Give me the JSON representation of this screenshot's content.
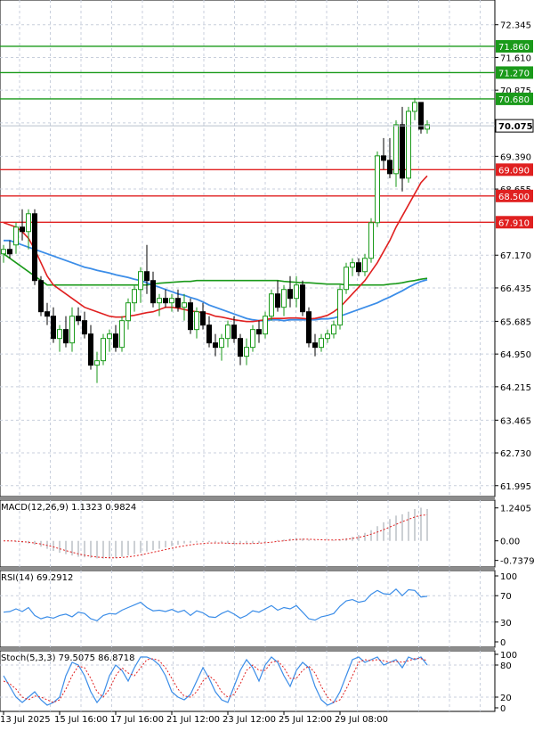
{
  "chart_data": {
    "type": "candlestick",
    "price_panel": {
      "y_axis_ticks": [
        "72.345",
        "71.610",
        "70.875",
        "70.140",
        "69.390",
        "68.655",
        "67.170",
        "66.435",
        "65.685",
        "64.950",
        "64.215",
        "63.465",
        "62.730",
        "61.995"
      ],
      "ylim": [
        61.75,
        72.9
      ],
      "current_price": "70.075",
      "levels": [
        {
          "label": "71.860",
          "value": 71.86,
          "color": "#1a9a1a"
        },
        {
          "label": "71.270",
          "value": 71.27,
          "color": "#1a9a1a"
        },
        {
          "label": "70.680",
          "value": 70.68,
          "color": "#1a9a1a"
        },
        {
          "label": "69.090",
          "value": 69.09,
          "color": "#e02020"
        },
        {
          "label": "68.500",
          "value": 68.5,
          "color": "#e02020"
        },
        {
          "label": "67.910",
          "value": 67.91,
          "color": "#e02020"
        }
      ],
      "candles": [
        [
          67.2,
          67.4,
          67.0,
          67.3
        ],
        [
          67.3,
          67.5,
          67.1,
          67.2
        ],
        [
          67.4,
          67.9,
          67.2,
          67.8
        ],
        [
          67.8,
          68.2,
          67.5,
          67.7
        ],
        [
          67.7,
          68.2,
          67.3,
          68.1
        ],
        [
          68.1,
          68.2,
          66.5,
          66.6
        ],
        [
          66.6,
          66.7,
          65.8,
          65.9
        ],
        [
          65.9,
          66.1,
          65.6,
          65.8
        ],
        [
          65.8,
          66.0,
          65.2,
          65.3
        ],
        [
          65.3,
          65.6,
          65.0,
          65.5
        ],
        [
          65.5,
          65.8,
          65.1,
          65.2
        ],
        [
          65.2,
          66.0,
          65.0,
          65.8
        ],
        [
          65.8,
          66.0,
          65.6,
          65.7
        ],
        [
          65.7,
          65.9,
          65.3,
          65.4
        ],
        [
          65.4,
          65.6,
          64.6,
          64.7
        ],
        [
          64.7,
          65.0,
          64.3,
          64.8
        ],
        [
          64.8,
          65.4,
          64.7,
          65.3
        ],
        [
          65.3,
          65.5,
          65.0,
          65.4
        ],
        [
          65.4,
          65.6,
          65.0,
          65.1
        ],
        [
          65.1,
          65.8,
          65.0,
          65.7
        ],
        [
          65.7,
          66.2,
          65.5,
          66.1
        ],
        [
          66.1,
          66.5,
          65.9,
          66.4
        ],
        [
          66.4,
          66.9,
          66.1,
          66.8
        ],
        [
          66.8,
          67.4,
          66.3,
          66.6
        ],
        [
          66.6,
          66.8,
          66.0,
          66.1
        ],
        [
          66.1,
          66.3,
          65.8,
          66.2
        ],
        [
          66.2,
          66.4,
          66.0,
          66.1
        ],
        [
          66.1,
          66.3,
          65.9,
          66.2
        ],
        [
          66.2,
          66.4,
          65.9,
          66.0
        ],
        [
          66.0,
          66.3,
          65.7,
          66.1
        ],
        [
          66.1,
          66.2,
          65.4,
          65.5
        ],
        [
          65.5,
          66.0,
          65.3,
          65.9
        ],
        [
          65.9,
          66.1,
          65.5,
          65.6
        ],
        [
          65.6,
          65.8,
          65.1,
          65.2
        ],
        [
          65.2,
          65.4,
          64.9,
          65.1
        ],
        [
          65.1,
          65.4,
          64.8,
          65.3
        ],
        [
          65.3,
          65.7,
          65.1,
          65.6
        ],
        [
          65.6,
          65.8,
          65.2,
          65.3
        ],
        [
          65.3,
          65.4,
          64.7,
          64.9
        ],
        [
          64.9,
          65.3,
          64.7,
          65.1
        ],
        [
          65.1,
          65.6,
          65.0,
          65.5
        ],
        [
          65.5,
          65.7,
          65.2,
          65.4
        ],
        [
          65.4,
          65.9,
          65.3,
          65.8
        ],
        [
          65.8,
          66.4,
          65.7,
          66.3
        ],
        [
          66.3,
          66.6,
          65.9,
          66.0
        ],
        [
          66.0,
          66.5,
          65.8,
          66.4
        ],
        [
          66.4,
          66.7,
          66.0,
          66.2
        ],
        [
          66.2,
          66.7,
          66.0,
          66.5
        ],
        [
          66.5,
          66.6,
          65.8,
          65.9
        ],
        [
          65.9,
          66.0,
          65.1,
          65.2
        ],
        [
          65.2,
          65.4,
          64.9,
          65.1
        ],
        [
          65.1,
          65.4,
          65.0,
          65.3
        ],
        [
          65.3,
          65.5,
          65.2,
          65.4
        ],
        [
          65.4,
          65.7,
          65.3,
          65.6
        ],
        [
          65.6,
          66.5,
          65.5,
          66.4
        ],
        [
          66.4,
          67.0,
          66.3,
          66.9
        ],
        [
          66.9,
          67.1,
          66.7,
          67.0
        ],
        [
          67.0,
          67.1,
          66.7,
          66.8
        ],
        [
          66.8,
          67.2,
          66.7,
          67.1
        ],
        [
          67.1,
          68.0,
          67.0,
          67.9
        ],
        [
          67.9,
          69.5,
          67.8,
          69.4
        ],
        [
          69.4,
          69.8,
          69.1,
          69.3
        ],
        [
          69.3,
          69.8,
          68.9,
          69.0
        ],
        [
          69.0,
          70.2,
          68.7,
          70.1
        ],
        [
          70.1,
          70.5,
          68.6,
          68.9
        ],
        [
          68.9,
          70.5,
          68.8,
          70.4
        ],
        [
          70.4,
          70.7,
          70.2,
          70.6
        ],
        [
          70.6,
          70.6,
          69.9,
          70.0
        ],
        [
          70.0,
          70.2,
          69.9,
          70.1
        ]
      ],
      "sma_fast_red": [
        67.9,
        67.85,
        67.8,
        67.7,
        67.55,
        67.3,
        67.0,
        66.7,
        66.5,
        66.4,
        66.3,
        66.2,
        66.1,
        66.0,
        65.95,
        65.9,
        65.85,
        65.8,
        65.78,
        65.78,
        65.8,
        65.82,
        65.85,
        65.88,
        65.9,
        65.95,
        66.0,
        66.0,
        65.98,
        65.95,
        65.92,
        65.9,
        65.88,
        65.85,
        65.8,
        65.78,
        65.75,
        65.72,
        65.7,
        65.68,
        65.68,
        65.7,
        65.72,
        65.75,
        65.75,
        65.75,
        65.76,
        65.76,
        65.75,
        65.74,
        65.75,
        65.78,
        65.82,
        65.9,
        66.0,
        66.15,
        66.3,
        66.45,
        66.6,
        66.8,
        67.0,
        67.25,
        67.5,
        67.8,
        68.05,
        68.3,
        68.55,
        68.8,
        68.95
      ],
      "sma_mid_blue": [
        67.5,
        67.5,
        67.45,
        67.4,
        67.35,
        67.3,
        67.25,
        67.2,
        67.15,
        67.1,
        67.05,
        67.0,
        66.95,
        66.9,
        66.87,
        66.83,
        66.8,
        66.77,
        66.73,
        66.7,
        66.67,
        66.63,
        66.6,
        66.55,
        66.5,
        66.45,
        66.4,
        66.35,
        66.3,
        66.27,
        66.22,
        66.18,
        66.12,
        66.05,
        66.0,
        65.95,
        65.9,
        65.85,
        65.8,
        65.75,
        65.72,
        65.7,
        65.7,
        65.72,
        65.72,
        65.7,
        65.72,
        65.72,
        65.72,
        65.72,
        65.72,
        65.74,
        65.74,
        65.76,
        65.8,
        65.85,
        65.9,
        65.95,
        66.0,
        66.05,
        66.1,
        66.17,
        66.23,
        66.3,
        66.37,
        66.45,
        66.52,
        66.58,
        66.62
      ],
      "sma_slow_green": [
        67.2,
        67.1,
        67.0,
        66.9,
        66.8,
        66.7,
        66.6,
        66.5,
        66.5,
        66.5,
        66.5,
        66.5,
        66.5,
        66.5,
        66.5,
        66.5,
        66.5,
        66.5,
        66.5,
        66.5,
        66.5,
        66.5,
        66.5,
        66.5,
        66.52,
        66.54,
        66.55,
        66.56,
        66.57,
        66.58,
        66.58,
        66.6,
        66.6,
        66.6,
        66.6,
        66.6,
        66.6,
        66.6,
        66.6,
        66.6,
        66.6,
        66.6,
        66.6,
        66.6,
        66.6,
        66.58,
        66.57,
        66.56,
        66.55,
        66.55,
        66.54,
        66.53,
        66.52,
        66.52,
        66.52,
        66.5,
        66.5,
        66.5,
        66.5,
        66.5,
        66.5,
        66.5,
        66.52,
        66.53,
        66.55,
        66.58,
        66.6,
        66.63,
        66.65
      ]
    },
    "macd_panel": {
      "label": "MACD(12,26,9) 1.1323 0.9824",
      "y_axis_ticks": [
        "1.2405",
        "0.00",
        "-0.7379"
      ],
      "ylim": [
        -0.85,
        1.4
      ],
      "histogram": [
        0.0,
        -0.02,
        -0.05,
        -0.07,
        -0.1,
        -0.15,
        -0.22,
        -0.3,
        -0.38,
        -0.45,
        -0.5,
        -0.55,
        -0.6,
        -0.62,
        -0.64,
        -0.66,
        -0.67,
        -0.66,
        -0.65,
        -0.6,
        -0.55,
        -0.5,
        -0.45,
        -0.4,
        -0.35,
        -0.3,
        -0.25,
        -0.2,
        -0.15,
        -0.1,
        -0.08,
        -0.06,
        -0.05,
        -0.05,
        -0.06,
        -0.08,
        -0.1,
        -0.12,
        -0.12,
        -0.12,
        -0.1,
        -0.08,
        -0.05,
        0.0,
        0.03,
        0.05,
        0.08,
        0.1,
        0.08,
        0.05,
        0.02,
        0.0,
        0.0,
        0.02,
        0.05,
        0.1,
        0.15,
        0.22,
        0.3,
        0.4,
        0.55,
        0.7,
        0.82,
        0.95,
        1.0,
        1.1,
        1.2,
        1.25,
        1.2
      ],
      "signal": [
        0.0,
        0.0,
        -0.01,
        -0.03,
        -0.05,
        -0.08,
        -0.12,
        -0.17,
        -0.23,
        -0.3,
        -0.37,
        -0.43,
        -0.49,
        -0.54,
        -0.58,
        -0.61,
        -0.63,
        -0.64,
        -0.64,
        -0.63,
        -0.6,
        -0.57,
        -0.53,
        -0.48,
        -0.43,
        -0.38,
        -0.33,
        -0.28,
        -0.23,
        -0.19,
        -0.15,
        -0.12,
        -0.1,
        -0.08,
        -0.08,
        -0.08,
        -0.09,
        -0.1,
        -0.1,
        -0.1,
        -0.1,
        -0.09,
        -0.07,
        -0.05,
        -0.02,
        0.0,
        0.03,
        0.05,
        0.06,
        0.06,
        0.05,
        0.04,
        0.03,
        0.03,
        0.04,
        0.06,
        0.09,
        0.13,
        0.18,
        0.25,
        0.33,
        0.42,
        0.52,
        0.62,
        0.72,
        0.81,
        0.9,
        0.96,
        0.98
      ]
    },
    "rsi_panel": {
      "label": "RSI(14) 69.2912",
      "y_axis_ticks": [
        "100",
        "70",
        "30",
        "0"
      ],
      "ylim": [
        0,
        100
      ],
      "values": [
        45,
        46,
        50,
        46,
        52,
        40,
        35,
        38,
        36,
        40,
        42,
        38,
        45,
        43,
        35,
        32,
        40,
        43,
        42,
        48,
        52,
        56,
        60,
        52,
        47,
        48,
        46,
        49,
        45,
        48,
        40,
        47,
        44,
        38,
        37,
        43,
        47,
        42,
        36,
        40,
        47,
        45,
        50,
        55,
        48,
        52,
        50,
        55,
        45,
        35,
        33,
        38,
        40,
        43,
        54,
        62,
        64,
        60,
        62,
        72,
        78,
        73,
        72,
        80,
        70,
        79,
        78,
        68,
        69
      ]
    },
    "stoch_panel": {
      "label": "Stoch(5,3,3) 79.5075 86.8718",
      "y_axis_ticks": [
        "100",
        "80",
        "20",
        "0"
      ],
      "ylim": [
        0,
        100
      ],
      "k": [
        60,
        40,
        20,
        10,
        20,
        30,
        15,
        5,
        10,
        20,
        60,
        85,
        80,
        60,
        30,
        10,
        25,
        60,
        80,
        70,
        50,
        75,
        95,
        95,
        90,
        80,
        60,
        30,
        20,
        15,
        25,
        50,
        75,
        55,
        30,
        15,
        10,
        40,
        70,
        90,
        75,
        50,
        80,
        95,
        85,
        60,
        40,
        70,
        85,
        75,
        40,
        15,
        5,
        10,
        30,
        60,
        90,
        95,
        85,
        90,
        95,
        80,
        85,
        90,
        75,
        95,
        90,
        95,
        80
      ],
      "d": [
        50,
        45,
        35,
        20,
        15,
        22,
        20,
        15,
        10,
        15,
        35,
        60,
        78,
        75,
        55,
        30,
        20,
        35,
        60,
        75,
        65,
        60,
        75,
        90,
        92,
        88,
        75,
        55,
        35,
        22,
        20,
        30,
        50,
        60,
        50,
        30,
        20,
        25,
        45,
        70,
        80,
        70,
        70,
        85,
        88,
        75,
        55,
        55,
        70,
        78,
        65,
        40,
        20,
        10,
        15,
        35,
        60,
        85,
        90,
        88,
        90,
        88,
        85,
        87,
        85,
        88,
        92,
        92,
        88
      ]
    },
    "x_axis_labels": [
      {
        "label": "13 Jul 2025",
        "index": 0
      },
      {
        "label": "15 Jul 16:00",
        "index": 9
      },
      {
        "label": "17 Jul 16:00",
        "index": 18
      },
      {
        "label": "21 Jul 12:00",
        "index": 27
      },
      {
        "label": "23 Jul 12:00",
        "index": 36
      },
      {
        "label": "25 Jul 12:00",
        "index": 45
      },
      {
        "label": "29 Jul 08:00",
        "index": 54
      }
    ],
    "colors": {
      "bull_body": "#ffffff",
      "bear_body": "#000000",
      "bull_border": "#1a9a1a",
      "bear_border": "#000000",
      "grid": "#c8cfdc",
      "sma_fast": "#e02020",
      "sma_mid": "#3b8de8",
      "sma_slow": "#1a9a1a",
      "macd_hist": "#9aa0a8",
      "macd_signal": "#e02020",
      "rsi": "#3b8de8",
      "stoch_k": "#3b8de8",
      "stoch_d": "#e02020"
    }
  }
}
